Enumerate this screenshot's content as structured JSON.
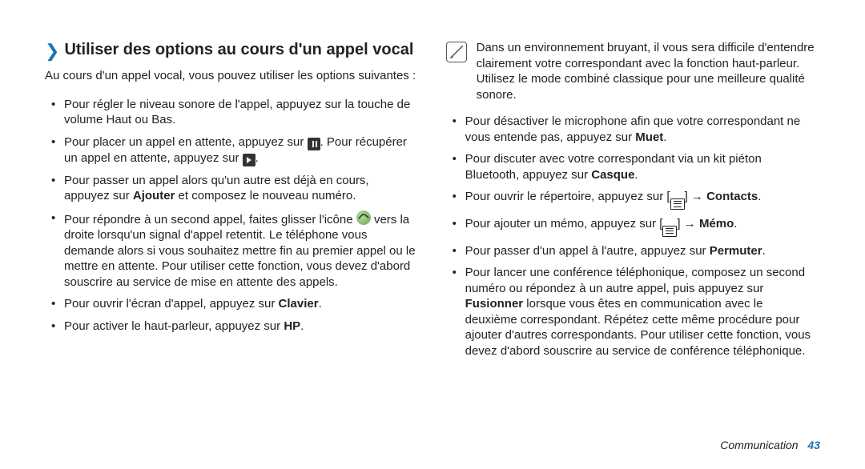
{
  "heading": "Utiliser des options au cours d'un appel vocal",
  "intro": "Au cours d'un appel vocal, vous pouvez utiliser les options suivantes :",
  "left_bullets": {
    "b1": "Pour régler le niveau sonore de l'appel, appuyez sur la touche de volume Haut ou Bas.",
    "b2a": "Pour placer un appel en attente, appuyez sur ",
    "b2b": ". Pour récupérer un appel en attente, appuyez sur ",
    "b2c": ".",
    "b3a": "Pour passer un appel alors qu'un autre est déjà en cours, appuyez sur ",
    "b3bold": "Ajouter",
    "b3b": " et composez le nouveau numéro.",
    "b4a": "Pour répondre à un second appel, faites glisser l'icône ",
    "b4b": " vers la droite lorsqu'un signal d'appel retentit. Le téléphone vous demande alors si vous souhaitez mettre fin au premier appel ou le mettre en attente. Pour utiliser cette fonction, vous devez d'abord souscrire au service de mise en attente des appels.",
    "b5a": "Pour ouvrir l'écran d'appel, appuyez sur ",
    "b5bold": "Clavier",
    "b5b": ".",
    "b6a": "Pour activer le haut-parleur, appuyez sur ",
    "b6bold": "HP",
    "b6b": "."
  },
  "note": "Dans un environnement bruyant, il vous sera difficile d'entendre clairement votre correspondant avec la fonction haut-parleur. Utilisez le mode combiné classique pour une meilleure qualité sonore.",
  "right_bullets": {
    "r1a": "Pour désactiver le microphone afin que votre correspondant ne vous entende pas, appuyez sur ",
    "r1bold": "Muet",
    "r1b": ".",
    "r2a": "Pour discuter avec votre correspondant via un kit piéton Bluetooth, appuyez sur ",
    "r2bold": "Casque",
    "r2b": ".",
    "r3a": "Pour ouvrir le répertoire, appuyez sur [",
    "r3arrow": "] → ",
    "r3bold": "Contacts",
    "r3b": ".",
    "r4a": "Pour ajouter un mémo, appuyez sur [",
    "r4arrow": "] → ",
    "r4bold": "Mémo",
    "r4b": ".",
    "r5a": "Pour passer d'un appel à l'autre, appuyez sur ",
    "r5bold": "Permuter",
    "r5b": ".",
    "r6a": "Pour lancer une conférence téléphonique, composez un second numéro ou répondez à un autre appel, puis appuyez sur ",
    "r6bold": "Fusionner",
    "r6b": " lorsque vous êtes en communication avec le deuxième correspondant. Répétez cette même procédure pour ajouter d'autres correspondants. Pour utiliser cette fonction, vous devez d'abord souscrire au service de conférence téléphonique."
  },
  "footer": {
    "section": "Communication",
    "page": "43"
  }
}
